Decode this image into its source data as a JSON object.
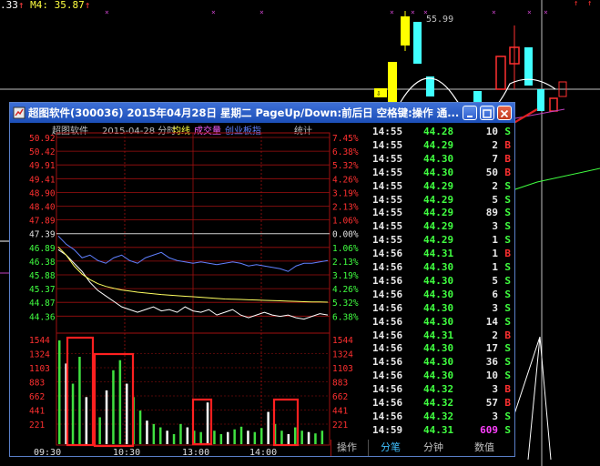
{
  "top_bar": {
    "left_value": ".33",
    "m4_label": "M4: 35.87",
    "up_arrow": "↑",
    "price_label": "55.99"
  },
  "window": {
    "title": "超图软件(300036) 2015年04月28日 星期二 PageUp/Down:前后日 空格键:操作 通...",
    "buttons": [
      "minimize",
      "maximize",
      "close"
    ]
  },
  "chart_header": {
    "name": "超图软件",
    "date": "2015-04-28 分时",
    "avg_label": "均线",
    "vol_label": "成交量",
    "index_label": "创业板指",
    "stats_label": "统计"
  },
  "chart_data": {
    "type": "line",
    "price_ticks_left": [
      "50.92",
      "50.42",
      "49.91",
      "49.41",
      "48.90",
      "48.40",
      "47.89",
      "47.39",
      "46.89",
      "46.38",
      "45.88",
      "45.37",
      "44.87",
      "44.36"
    ],
    "pct_ticks_right": [
      "7.45%",
      "6.38%",
      "5.32%",
      "4.26%",
      "3.19%",
      "2.13%",
      "1.06%",
      "0.00%",
      "1.06%",
      "2.13%",
      "3.19%",
      "4.26%",
      "5.32%",
      "6.38%"
    ],
    "volume_ticks": [
      "1544",
      "1324",
      "1103",
      "883",
      "662",
      "441",
      "221"
    ],
    "time_ticks": [
      "09:30",
      "10:30",
      "13:00",
      "14:00"
    ],
    "series": [
      {
        "name": "price",
        "color": "#ffffff",
        "values": [
          46.8,
          46.6,
          46.3,
          46.0,
          45.6,
          45.3,
          45.1,
          44.9,
          44.7,
          44.6,
          44.5,
          44.6,
          44.7,
          44.55,
          44.6,
          44.5,
          44.7,
          44.55,
          44.5,
          44.6,
          44.4,
          44.5,
          44.6,
          44.4,
          44.3,
          44.4,
          44.5,
          44.4,
          44.35,
          44.4,
          44.3,
          44.25,
          44.35,
          44.45,
          44.4
        ]
      },
      {
        "name": "average",
        "color": "#ffff60",
        "values": [
          46.9,
          46.6,
          46.2,
          45.9,
          45.7,
          45.55,
          45.45,
          45.38,
          45.32,
          45.28,
          45.24,
          45.21,
          45.18,
          45.15,
          45.13,
          45.11,
          45.09,
          45.07,
          45.05,
          45.03,
          45.01,
          44.99,
          44.98,
          44.97,
          44.96,
          44.95,
          44.94,
          44.93,
          44.92,
          44.91,
          44.9,
          44.89,
          44.88,
          44.88,
          44.87
        ]
      },
      {
        "name": "index",
        "color": "#6080ff",
        "values": [
          47.3,
          47.0,
          46.8,
          46.5,
          46.6,
          46.4,
          46.3,
          46.5,
          46.6,
          46.4,
          46.3,
          46.5,
          46.6,
          46.7,
          46.5,
          46.4,
          46.35,
          46.3,
          46.35,
          46.3,
          46.25,
          46.3,
          46.35,
          46.3,
          46.2,
          46.25,
          46.2,
          46.15,
          46.1,
          46.0,
          46.2,
          46.3,
          46.3,
          46.35,
          46.4
        ]
      }
    ],
    "volume": [
      1544,
      1200,
      900,
      1300,
      700,
      500,
      400,
      800,
      1100,
      1250,
      900,
      700,
      500,
      350,
      300,
      250,
      200,
      150,
      300,
      250,
      200,
      180,
      620,
      200,
      150,
      180,
      220,
      260,
      200,
      180,
      240,
      480,
      300,
      200,
      150,
      250,
      200,
      180,
      160,
      200
    ],
    "highlight_boxes": 4
  },
  "trades": [
    {
      "time": "14:55",
      "price": "44.28",
      "vol": "10",
      "side": "S"
    },
    {
      "time": "14:55",
      "price": "44.29",
      "vol": "2",
      "side": "B"
    },
    {
      "time": "14:55",
      "price": "44.30",
      "vol": "7",
      "side": "B"
    },
    {
      "time": "14:55",
      "price": "44.30",
      "vol": "50",
      "side": "B"
    },
    {
      "time": "14:55",
      "price": "44.29",
      "vol": "2",
      "side": "S"
    },
    {
      "time": "14:55",
      "price": "44.29",
      "vol": "5",
      "side": "S"
    },
    {
      "time": "14:55",
      "price": "44.29",
      "vol": "89",
      "side": "S"
    },
    {
      "time": "14:55",
      "price": "44.29",
      "vol": "3",
      "side": "S"
    },
    {
      "time": "14:55",
      "price": "44.29",
      "vol": "1",
      "side": "S"
    },
    {
      "time": "14:56",
      "price": "44.31",
      "vol": "1",
      "side": "B"
    },
    {
      "time": "14:56",
      "price": "44.30",
      "vol": "1",
      "side": "S"
    },
    {
      "time": "14:56",
      "price": "44.30",
      "vol": "5",
      "side": "S"
    },
    {
      "time": "14:56",
      "price": "44.30",
      "vol": "6",
      "side": "S"
    },
    {
      "time": "14:56",
      "price": "44.30",
      "vol": "3",
      "side": "S"
    },
    {
      "time": "14:56",
      "price": "44.30",
      "vol": "14",
      "side": "S"
    },
    {
      "time": "14:56",
      "price": "44.31",
      "vol": "2",
      "side": "B"
    },
    {
      "time": "14:56",
      "price": "44.30",
      "vol": "17",
      "side": "S"
    },
    {
      "time": "14:56",
      "price": "44.30",
      "vol": "36",
      "side": "S"
    },
    {
      "time": "14:56",
      "price": "44.30",
      "vol": "10",
      "side": "S"
    },
    {
      "time": "14:56",
      "price": "44.32",
      "vol": "3",
      "side": "B"
    },
    {
      "time": "14:56",
      "price": "44.32",
      "vol": "57",
      "side": "B"
    },
    {
      "time": "14:56",
      "price": "44.32",
      "vol": "3",
      "side": "S"
    },
    {
      "time": "14:59",
      "price": "44.31",
      "vol": "609",
      "side": "S"
    }
  ],
  "tabs": {
    "operate": "操作",
    "tick": "分笔",
    "minute": "分钟",
    "value": "数值"
  },
  "colors": {
    "up": "#ff3030",
    "down": "#40ff40",
    "grid": "#a01010",
    "title_bar": "#2a5fcc",
    "accent": "#ffff40"
  }
}
